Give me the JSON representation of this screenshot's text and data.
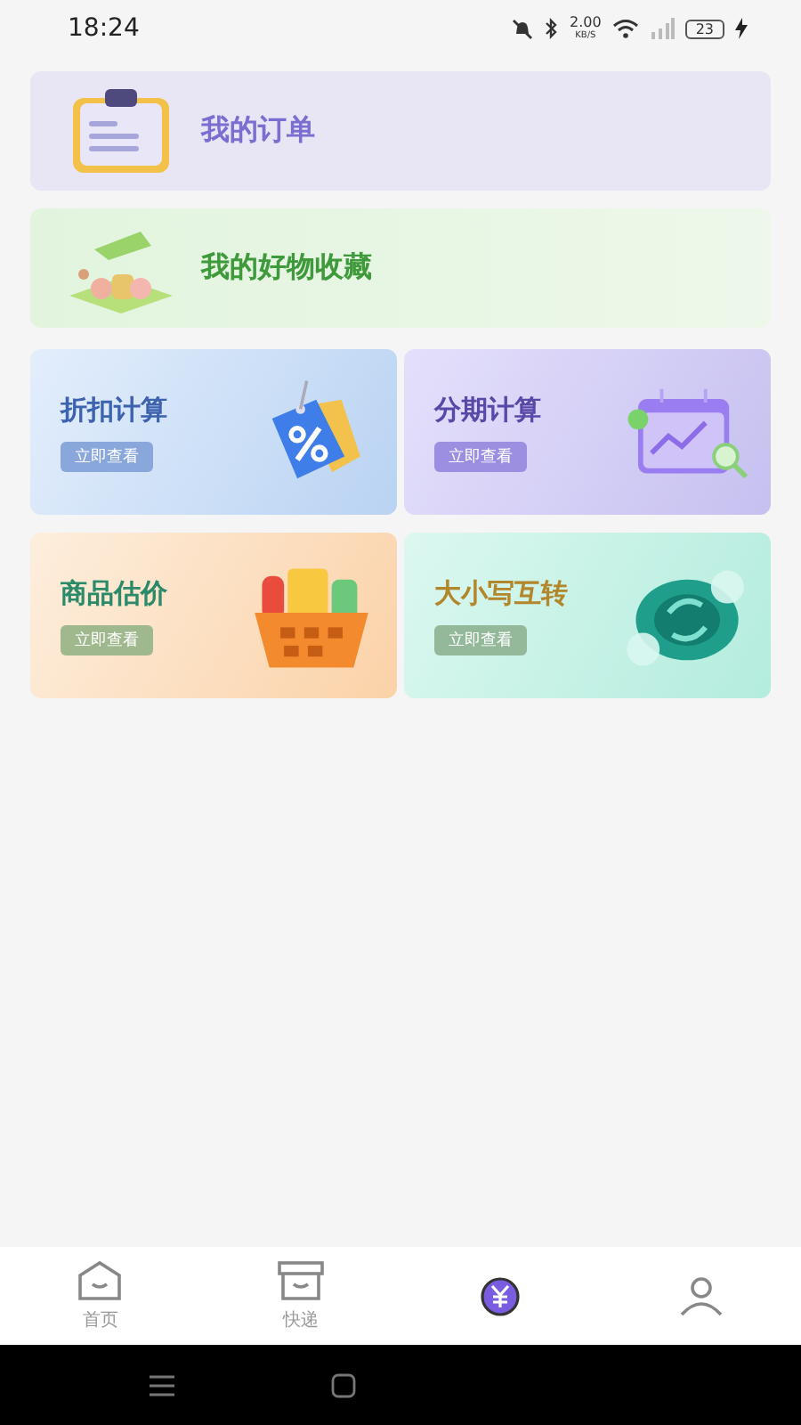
{
  "status_bar": {
    "time": "18:24",
    "speed": "2.00",
    "speed_unit": "KB/S",
    "battery": "23"
  },
  "menu_rows": [
    {
      "label": "我的订单"
    },
    {
      "label": "我的好物收藏"
    }
  ],
  "tools": [
    {
      "title": "折扣计算",
      "button": "立即查看"
    },
    {
      "title": "分期计算",
      "button": "立即查看"
    },
    {
      "title": "商品估价",
      "button": "立即查看"
    },
    {
      "title": "大小写互转",
      "button": "立即查看"
    }
  ],
  "tab_bar": [
    {
      "label": "首页",
      "selected": false
    },
    {
      "label": "快递",
      "selected": false
    },
    {
      "selected": true
    },
    {
      "selected": false
    }
  ]
}
